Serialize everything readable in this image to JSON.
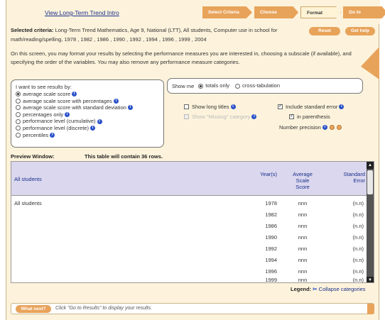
{
  "header": {
    "intro_link": "View Long-Term Trend Intro",
    "steps": [
      "Select Criteria",
      "Choose Year(s)",
      "Format Table",
      "Go to Results"
    ],
    "active_step": 2
  },
  "criteria": {
    "label": "Selected criteria:",
    "text": "Long-Term Trend Mathematics, Age 9, National (LTT), All students, Computer use in school for math/reading/spelling, 1978 , 1982 , 1986 , 1990 , 1992 , 1994 , 1996 , 1999 , 2004",
    "reset_label": "Reset",
    "help_label": "Get help"
  },
  "instructions": "On this screen, you may format your results by selecting the performance measures you are interested in, choosing a subscale (if available), and specifying the order of the variables. You may also remove any performance measure categories.",
  "results_options": {
    "title": "I want to see results by:",
    "options": [
      {
        "label": "average scale score",
        "selected": true
      },
      {
        "label": "average scale score with percentages",
        "selected": false
      },
      {
        "label": "average scale score with standard deviation",
        "selected": false
      },
      {
        "label": "percentages only",
        "selected": false
      },
      {
        "label": "performance level (cumulative)",
        "selected": false
      },
      {
        "label": "performance level (discrete)",
        "selected": false
      },
      {
        "label": "percentiles",
        "selected": false
      }
    ]
  },
  "show_me": {
    "label": "Show me",
    "options": [
      {
        "label": "totals only",
        "selected": true
      },
      {
        "label": "cross-tabulation",
        "selected": false
      }
    ]
  },
  "format": {
    "show_long_titles": "Show long titles",
    "show_missing": "Show \"Missing\" category",
    "include_se": "Include standard error",
    "in_parenthesis": "in parenthesis",
    "number_precision": "Number precision"
  },
  "preview": {
    "title": "Preview Window:",
    "rows_text": "This table will contain 36 rows.",
    "headers": {
      "group": "All students",
      "year": "Year(s)",
      "avg": [
        "Average",
        "Scale",
        "Score"
      ],
      "se": [
        "Standard",
        "Error"
      ]
    },
    "row_label": "All students",
    "rows": [
      {
        "year": "1978",
        "avg": "nnn",
        "se": "(n.n)"
      },
      {
        "year": "1982",
        "avg": "nnn",
        "se": "(n.n)"
      },
      {
        "year": "1986",
        "avg": "nnn",
        "se": "(n.n)"
      },
      {
        "year": "1990",
        "avg": "nnn",
        "se": "(n.n)"
      },
      {
        "year": "1992",
        "avg": "nnn",
        "se": "(n.n)"
      },
      {
        "year": "1994",
        "avg": "nnn",
        "se": "(n.n)"
      },
      {
        "year": "1996",
        "avg": "nnn",
        "se": "(n.n)"
      },
      {
        "year": "1999",
        "avg": "nnn",
        "se": "(n.n)"
      }
    ]
  },
  "legend": {
    "label": "Legend:",
    "collapse": "Collapse categories"
  },
  "what_next": {
    "button": "What next?",
    "text": "Click \"Go to Results\" to display your results."
  },
  "colors": {
    "accent": "#e8a35a",
    "background": "#fdf3dc",
    "header_row": "#dad7ee",
    "link": "#1a2f8a",
    "info": "#2a52c9"
  }
}
